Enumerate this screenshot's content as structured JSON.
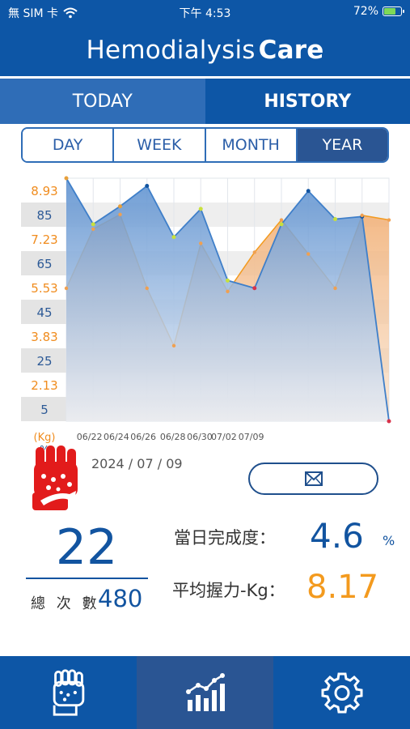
{
  "status_bar": {
    "carrier": "無 SIM 卡",
    "time": "下午 4:53",
    "battery": "72%",
    "battery_level": 0.72,
    "icons": [
      "wifi-icon",
      "battery-charging-icon"
    ]
  },
  "app": {
    "title_regular": "Hemodialysis",
    "title_bold": "Care",
    "colors": {
      "primary": "#0d56a6",
      "tab_inactive": "#2f6db7",
      "active_segment": "#2a5593",
      "orange": "#f39a1e",
      "blue": "#1254a0"
    }
  },
  "tabs": {
    "today": "TODAY",
    "history": "HISTORY",
    "active": "history"
  },
  "range_tabs": {
    "items": [
      "DAY",
      "WEEK",
      "MONTH",
      "YEAR"
    ],
    "active": "YEAR"
  },
  "chart_data": {
    "type": "area",
    "y_left_labels": [
      "8.93",
      "85",
      "7.23",
      "65",
      "5.53",
      "45",
      "3.83",
      "25",
      "2.13",
      "5"
    ],
    "y_unit_kg": "(Kg)",
    "y_unit_pct": "%",
    "x_labels": [
      "06/22",
      "06/24",
      "06/26",
      "06/28",
      "06/30",
      "07/02",
      "07/09"
    ],
    "percent_axis": {
      "min": 0,
      "max": 95
    },
    "kg_axis": {
      "min": 1.28,
      "max": 9.78
    },
    "series": [
      {
        "unit": "%",
        "color": "#5b96d6",
        "values": [
          95,
          77,
          84,
          92,
          72,
          83,
          55,
          52,
          77,
          90,
          79,
          80,
          0
        ]
      },
      {
        "unit": "Kg",
        "color": "#f39a1e",
        "values": [
          5.93,
          8.0,
          8.51,
          5.93,
          3.92,
          7.5,
          5.82,
          7.19,
          8.32,
          7.13,
          5.93,
          8.48,
          8.32
        ]
      }
    ]
  },
  "summary": {
    "date": "2024 / 07 / 09",
    "count": "22",
    "total_label": "總 次 數",
    "total_value": "480",
    "completion_label": "當日完成度：",
    "completion_value": "4.6",
    "completion_unit": "%",
    "grip_label": "平均握力-Kg：",
    "grip_value": "8.17",
    "mail_icon": "mail-icon",
    "fist_icon": "fist-icon"
  },
  "bottom_nav": {
    "items": [
      {
        "icon": "fist-icon"
      },
      {
        "icon": "chart-icon"
      },
      {
        "icon": "gear-icon"
      }
    ],
    "active_index": 1
  }
}
